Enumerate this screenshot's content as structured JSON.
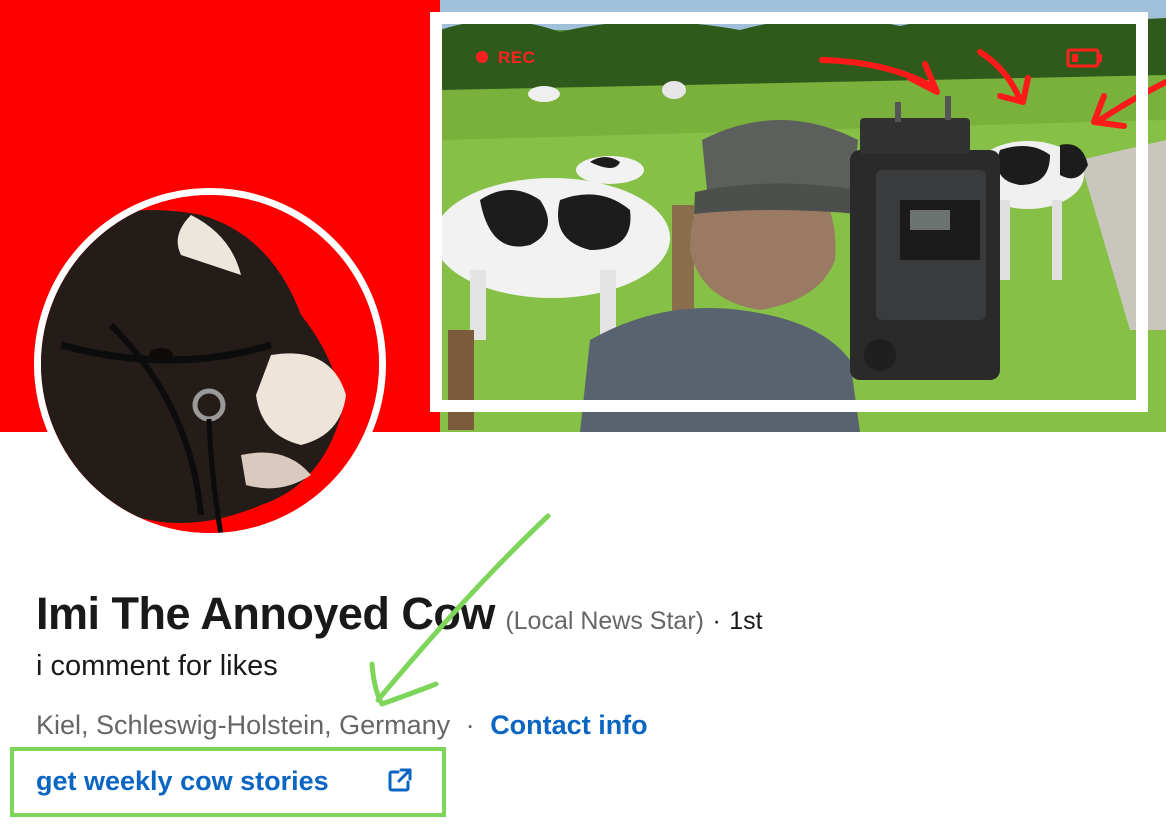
{
  "profile": {
    "name": "Imi The Annoyed Cow",
    "pronoun": "(Local News Star)",
    "degree_separator": "·",
    "degree": "1st",
    "headline": "i comment for likes",
    "location": "Kiel, Schleswig-Holstein, Germany",
    "location_separator": "·",
    "contact_info": "Contact info",
    "custom_link": "get weekly cow stories"
  },
  "banner": {
    "overlay_text": "REC",
    "background_color": "#ff0000"
  },
  "icons": {
    "external_link": "external-link-icon",
    "record": "record-dot-icon",
    "battery": "battery-icon"
  },
  "colors": {
    "link": "#0a66c2",
    "annotation_green": "#7dd55a",
    "annotation_red": "#ff1a1a"
  }
}
